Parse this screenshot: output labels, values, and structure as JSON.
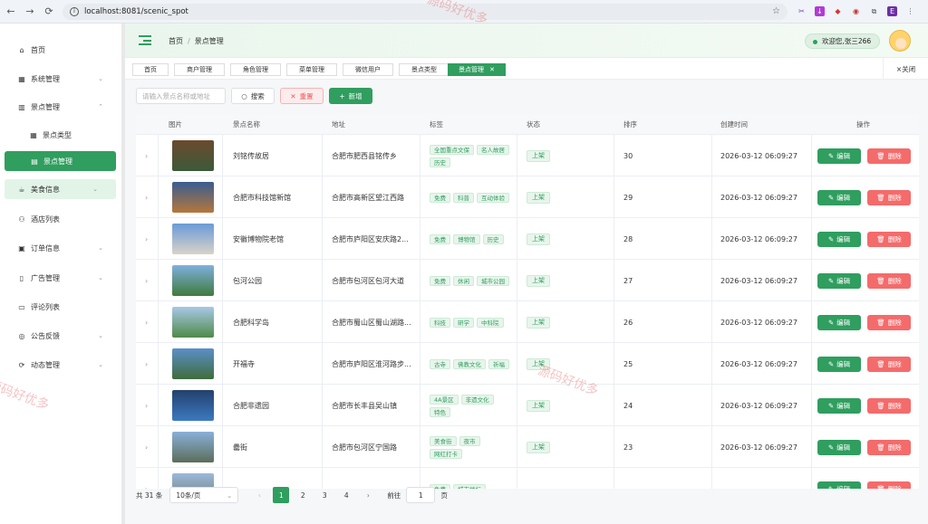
{
  "browser": {
    "url": "localhost:8081/scenic_spot",
    "profile_initial": "E"
  },
  "sidebar": {
    "items": [
      {
        "label": "首页",
        "icon": "home-icon"
      },
      {
        "label": "系统管理",
        "icon": "grid-icon"
      },
      {
        "label": "景点管理",
        "icon": "building-icon"
      },
      {
        "label": "景点类型",
        "icon": "grid-icon"
      },
      {
        "label": "景点管理",
        "icon": "doc-icon"
      },
      {
        "label": "美食信息",
        "icon": "food-icon"
      },
      {
        "label": "酒店列表",
        "icon": "hotel-icon"
      },
      {
        "label": "订单信息",
        "icon": "order-icon"
      },
      {
        "label": "广告管理",
        "icon": "phone-icon"
      },
      {
        "label": "评论列表",
        "icon": "comment-icon"
      },
      {
        "label": "公告反馈",
        "icon": "notice-icon"
      },
      {
        "label": "动态管理",
        "icon": "refresh-icon"
      }
    ]
  },
  "header": {
    "breadcrumb": [
      "首页",
      "景点管理"
    ],
    "welcome": "欢迎您,张三266"
  },
  "tabs": [
    "首页",
    "商户管理",
    "角色管理",
    "菜单管理",
    "微信用户",
    "景点类型",
    "景点管理"
  ],
  "close_all": "×关闭",
  "toolbar": {
    "search_placeholder": "请输入景点名称或地址",
    "search": "搜索",
    "reset": "重置",
    "add": "新增"
  },
  "table": {
    "headers": [
      "图片",
      "景点名称",
      "地址",
      "标签",
      "状态",
      "排序",
      "创建时间",
      "操作"
    ],
    "edit_label": "编辑",
    "delete_label": "删除",
    "rows": [
      {
        "name": "刘铭传故居",
        "address": "合肥市肥西县铭传乡",
        "tags": [
          "全国重点文保",
          "名人故居",
          "历史"
        ],
        "status": "上架",
        "sort": "30",
        "created": "2026-03-12 06:09:27",
        "thumb": [
          "#6b4a2e",
          "#3c5a3a"
        ]
      },
      {
        "name": "合肥市科技馆新馆",
        "address": "合肥市高新区望江西路",
        "tags": [
          "免费",
          "科普",
          "互动体验"
        ],
        "status": "上架",
        "sort": "29",
        "created": "2026-03-12 06:09:27",
        "thumb": [
          "#3a5d8f",
          "#b6763c"
        ]
      },
      {
        "name": "安徽博物院老馆",
        "address": "合肥市庐阳区安庆路2...",
        "tags": [
          "免费",
          "博物馆",
          "历史"
        ],
        "status": "上架",
        "sort": "28",
        "created": "2026-03-12 06:09:27",
        "thumb": [
          "#6a9bd8",
          "#d9d3c8"
        ]
      },
      {
        "name": "包河公园",
        "address": "合肥市包河区包河大道",
        "tags": [
          "免费",
          "休闲",
          "城市公园"
        ],
        "status": "上架",
        "sort": "27",
        "created": "2026-03-12 06:09:27",
        "thumb": [
          "#7fb0de",
          "#3f7a3d"
        ]
      },
      {
        "name": "合肥科学岛",
        "address": "合肥市蜀山区蜀山湖路...",
        "tags": [
          "科技",
          "研学",
          "中科院"
        ],
        "status": "上架",
        "sort": "26",
        "created": "2026-03-12 06:09:27",
        "thumb": [
          "#a9c8e6",
          "#4f8a4a"
        ]
      },
      {
        "name": "开福寺",
        "address": "合肥市庐阳区淮河路步...",
        "tags": [
          "古寺",
          "佛教文化",
          "祈福"
        ],
        "status": "上架",
        "sort": "25",
        "created": "2026-03-12 06:09:27",
        "thumb": [
          "#5b8fc9",
          "#3f6d3c"
        ]
      },
      {
        "name": "合肥非遗园",
        "address": "合肥市长丰县吴山镇",
        "tags": [
          "4A景区",
          "非遗文化",
          "特色"
        ],
        "status": "上架",
        "sort": "24",
        "created": "2026-03-12 06:09:27",
        "thumb": [
          "#23406e",
          "#3c7ac0"
        ]
      },
      {
        "name": "罍街",
        "address": "合肥市包河区宁国路",
        "tags": [
          "美食街",
          "夜市",
          "网红打卡"
        ],
        "status": "上架",
        "sort": "23",
        "created": "2026-03-12 06:09:27",
        "thumb": [
          "#8ab0d8",
          "#5b6d5a"
        ]
      },
      {
        "name": "",
        "address": "",
        "tags": [
          "免费",
          "城市地标"
        ],
        "status": "",
        "sort": "",
        "created": "",
        "thumb": [
          "#9bb8dc",
          "#6e7b6d"
        ]
      }
    ]
  },
  "pager": {
    "total": "共 31 条",
    "page_size": "10条/页",
    "pages": [
      "1",
      "2",
      "3",
      "4"
    ],
    "goto_label": "前往",
    "goto_value": "1",
    "page_suffix": "页"
  },
  "watermark": "源码好优多",
  "colors": {
    "primary": "#2f9e5f",
    "danger": "#f46b6b"
  }
}
